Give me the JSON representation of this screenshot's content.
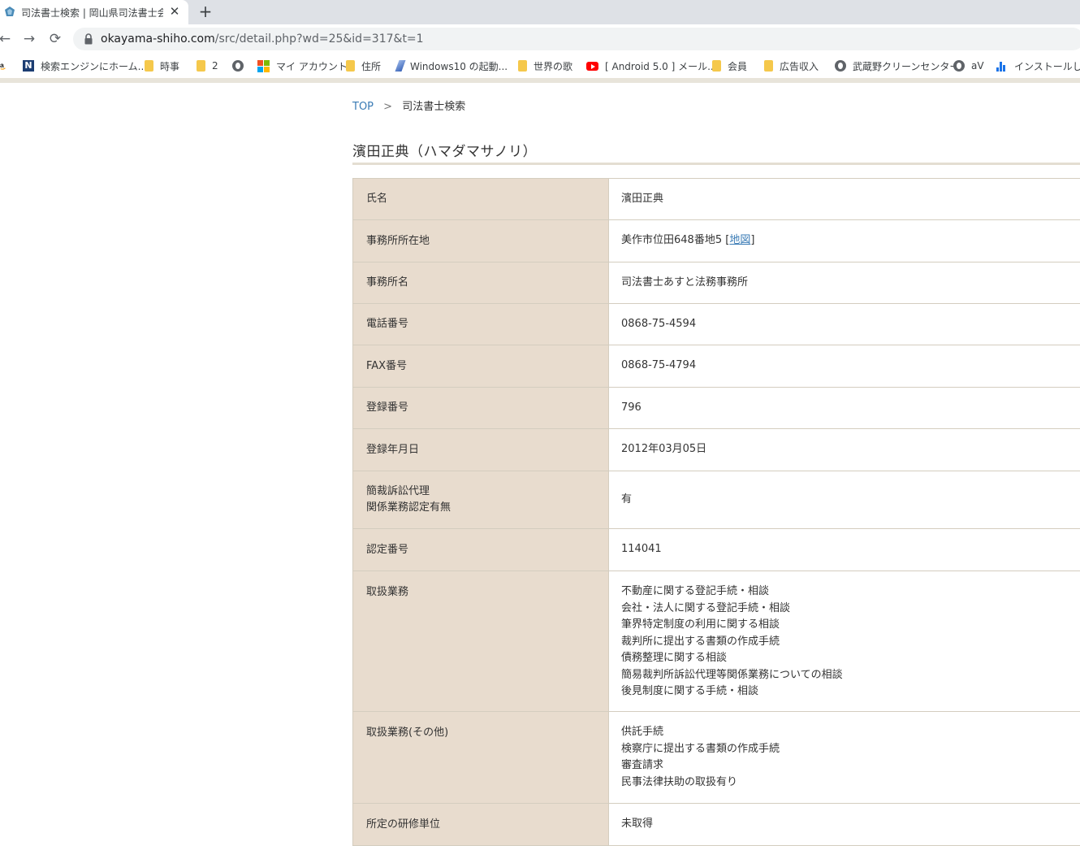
{
  "browser": {
    "tab_title": "司法書士検索 | 岡山県司法書士会",
    "close_glyph": "✕",
    "newtab_glyph": "+",
    "back_glyph": "←",
    "forward_glyph": "→",
    "reload_glyph": "⟳",
    "url_host": "okayama-shiho.com",
    "url_path": "/src/detail.php?wd=25&id=317&t=1"
  },
  "bookmarks": [
    {
      "label": "",
      "icon": "amazon-icon"
    },
    {
      "label": "検索エンジンにホーム...",
      "icon": "n-icon"
    },
    {
      "label": "時事",
      "icon": "folder-icon"
    },
    {
      "label": "2",
      "icon": "folder-icon"
    },
    {
      "label": "",
      "icon": "globe-icon"
    },
    {
      "label": "マイ アカウント",
      "icon": "microsoft-icon"
    },
    {
      "label": "住所",
      "icon": "folder-icon"
    },
    {
      "label": "Windows10 の起動...",
      "icon": "windows-icon"
    },
    {
      "label": "世界の歌",
      "icon": "folder-icon"
    },
    {
      "label": "[ Android 5.0 ] メール...",
      "icon": "youtube-icon"
    },
    {
      "label": "会員",
      "icon": "folder-icon"
    },
    {
      "label": "広告収入",
      "icon": "folder-icon"
    },
    {
      "label": "武蔵野クリーンセンター",
      "icon": "globe-icon"
    },
    {
      "label": "aV",
      "icon": "globe-icon"
    },
    {
      "label": "インストールしてい",
      "icon": "bar-chart-icon"
    }
  ],
  "breadcrumb": {
    "top": "TOP",
    "separator": ">",
    "current": "司法書士検索"
  },
  "page_title": "濱田正典（ハマダマサノリ）",
  "rows": {
    "name": {
      "label": "氏名",
      "value": "濱田正典"
    },
    "address": {
      "label": "事務所所在地",
      "value": "美作市位田648番地5",
      "link_open": "[",
      "link_text": "地図",
      "link_close": "]"
    },
    "office": {
      "label": "事務所名",
      "value": "司法書士あすと法務事務所"
    },
    "phone": {
      "label": "電話番号",
      "value": "0868-75-4594"
    },
    "fax": {
      "label": "FAX番号",
      "value": "0868-75-4794"
    },
    "reg_no": {
      "label": "登録番号",
      "value": "796"
    },
    "reg_date": {
      "label": "登録年月日",
      "value": "2012年03月05日"
    },
    "certified": {
      "label_line1": "簡裁訴訟代理",
      "label_line2": "関係業務認定有無",
      "value": "有"
    },
    "cert_no": {
      "label": "認定番号",
      "value": "114041"
    },
    "services": {
      "label": "取扱業務",
      "items": [
        "不動産に関する登記手続・相談",
        "会社・法人に関する登記手続・相談",
        "筆界特定制度の利用に関する相談",
        "裁判所に提出する書類の作成手続",
        "債務整理に関する相談",
        "簡易裁判所訴訟代理等関係業務についての相談",
        "後見制度に関する手続・相談"
      ]
    },
    "services_other": {
      "label": "取扱業務(その他)",
      "items": [
        "供託手続",
        "検察庁に提出する書類の作成手続",
        "審査請求",
        "民事法律扶助の取扱有り"
      ]
    },
    "training": {
      "label": "所定の研修単位",
      "value": "未取得"
    }
  }
}
